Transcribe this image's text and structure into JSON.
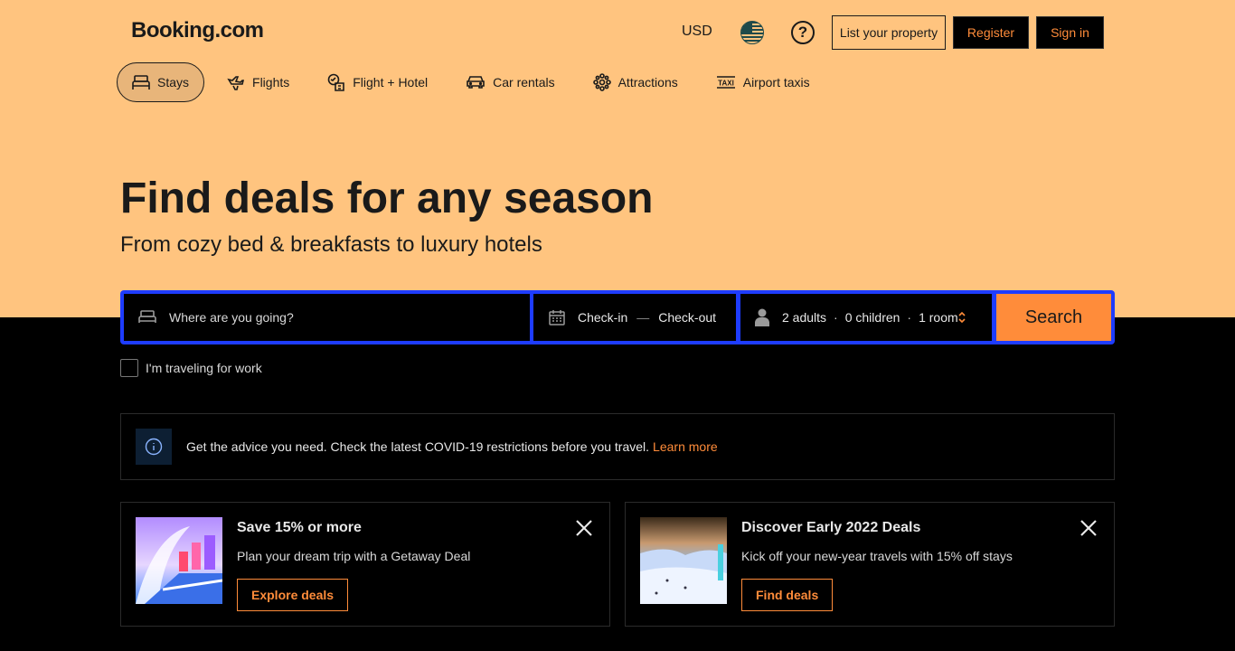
{
  "header": {
    "logo": "Booking.com",
    "currency": "USD",
    "list_property": "List your property",
    "register": "Register",
    "sign_in": "Sign in"
  },
  "nav": {
    "items": [
      {
        "label": "Stays",
        "icon": "bed-icon",
        "active": true
      },
      {
        "label": "Flights",
        "icon": "plane-icon"
      },
      {
        "label": "Flight + Hotel",
        "icon": "flight-hotel-icon"
      },
      {
        "label": "Car rentals",
        "icon": "car-icon"
      },
      {
        "label": "Attractions",
        "icon": "attractions-icon"
      },
      {
        "label": "Airport taxis",
        "icon": "taxi-icon"
      }
    ]
  },
  "hero": {
    "title": "Find deals for any season",
    "subtitle": "From cozy bed & breakfasts to luxury hotels"
  },
  "search": {
    "destination_placeholder": "Where are you going?",
    "check_in": "Check-in",
    "check_out": "Check-out",
    "adults": "2 adults",
    "children": "0 children",
    "rooms": "1 room",
    "button": "Search",
    "work_travel": "I'm traveling for work"
  },
  "advice": {
    "text": "Get the advice you need. Check the latest COVID-19 restrictions before you travel.",
    "link": "Learn more"
  },
  "cards": [
    {
      "title": "Save 15% or more",
      "description": "Plan your dream trip with a Getaway Deal",
      "button": "Explore deals"
    },
    {
      "title": "Discover Early 2022 Deals",
      "description": "Kick off your new-year travels with 15% off stays",
      "button": "Find deals"
    }
  ],
  "colors": {
    "hero_bg": "#ffc47f",
    "accent": "#ff8c3a",
    "search_border": "#1e3cff",
    "page_bg": "#000000"
  }
}
